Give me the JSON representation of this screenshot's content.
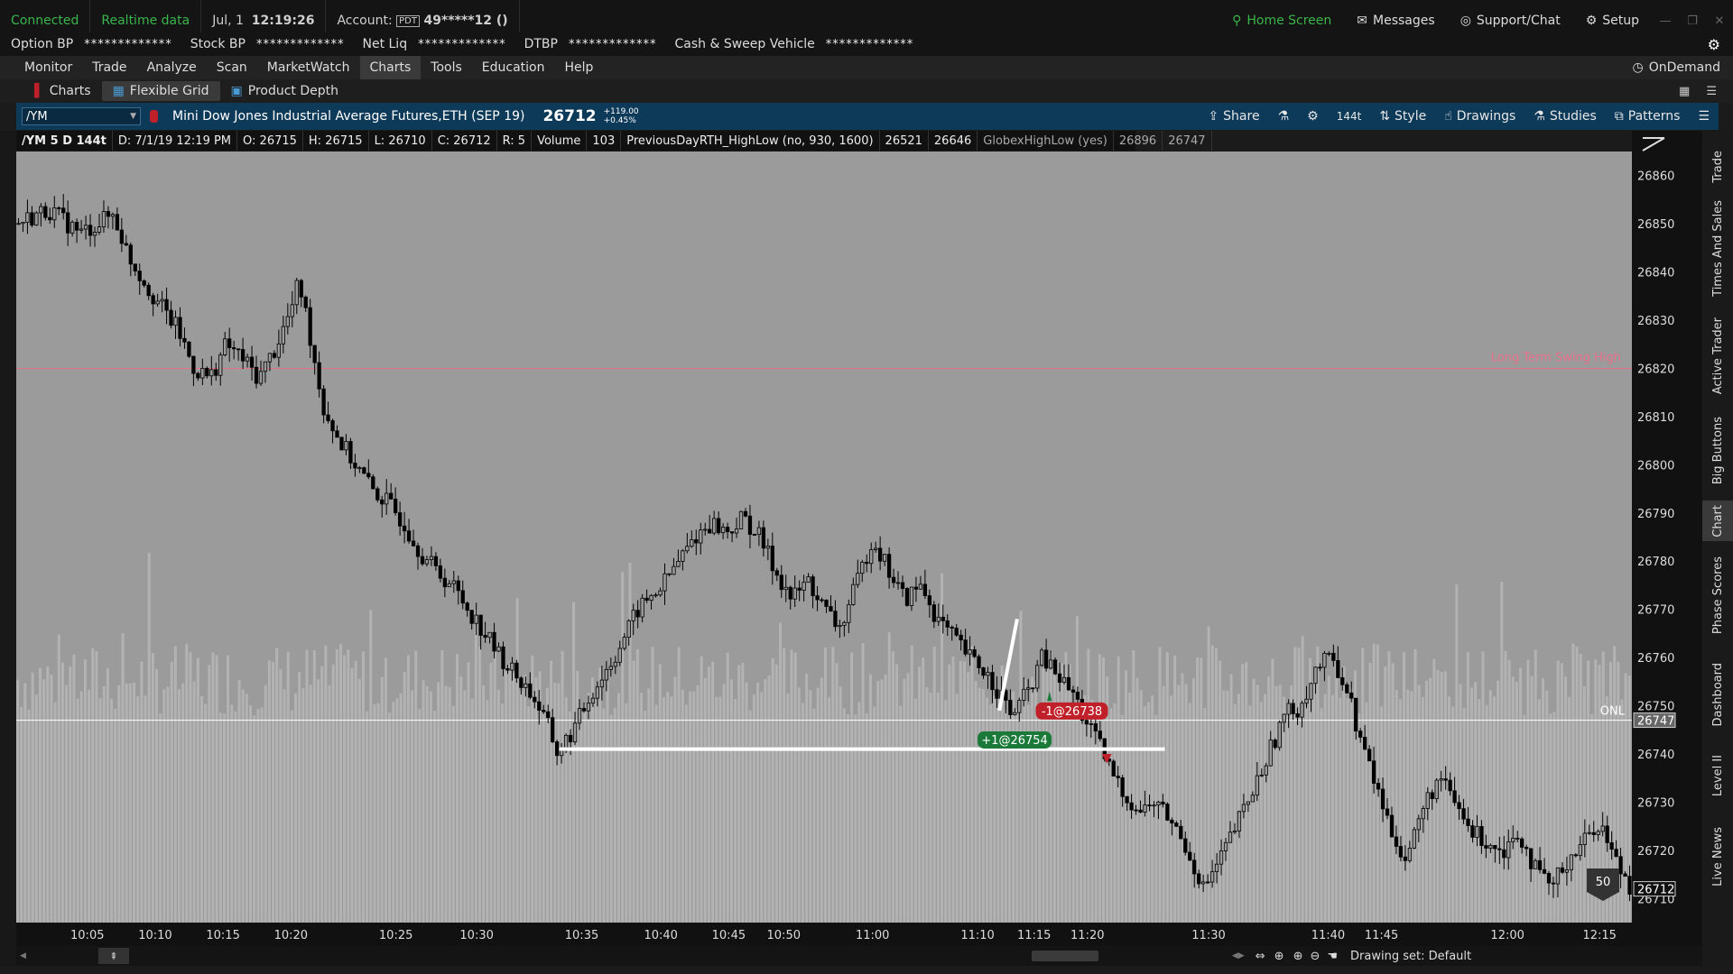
{
  "status": {
    "connected": "Connected",
    "realtime": "Realtime data",
    "date": "Jul, 1",
    "time": "12:19:26",
    "account_label": "Account:",
    "account_tag": "PDT",
    "account_value": "49*****12 ()",
    "home_screen": "Home Screen",
    "messages": "Messages",
    "support": "Support/Chat",
    "setup": "Setup"
  },
  "balances": [
    {
      "label": "Option BP",
      "value": "*************"
    },
    {
      "label": "Stock BP",
      "value": "*************"
    },
    {
      "label": "Net Liq",
      "value": "*************"
    },
    {
      "label": "DTBP",
      "value": "*************"
    },
    {
      "label": "Cash & Sweep Vehicle",
      "value": "*************"
    }
  ],
  "menu": [
    "Monitor",
    "Trade",
    "Analyze",
    "Scan",
    "MarketWatch",
    "Charts",
    "Tools",
    "Education",
    "Help"
  ],
  "menu_active": "Charts",
  "ondemand": "OnDemand",
  "subtabs": [
    "Charts",
    "Flexible Grid",
    "Product Depth"
  ],
  "header": {
    "symbol": "/YM",
    "description": "Mini Dow Jones Industrial Average Futures,ETH (SEP 19)",
    "last": "26712",
    "change": "+119.00",
    "change_pct": "+0.45%",
    "share": "Share",
    "ticks": "144t",
    "style": "Style",
    "drawings": "Drawings",
    "studies": "Studies",
    "patterns": "Patterns"
  },
  "info": {
    "symbol": "/YM 5 D 144t",
    "date": "D: 7/1/19 12:19 PM",
    "open": "O: 26715",
    "high": "H: 26715",
    "low": "L: 26710",
    "close": "C: 26712",
    "range": "R: 5",
    "volume_label": "Volume",
    "volume": "103",
    "study1": "PreviousDayRTH_HighLow (no, 930, 1600)",
    "study1_v1": "26521",
    "study1_v2": "26646",
    "study2": "GlobexHighLow (yes)",
    "study2_v1": "26896",
    "study2_v2": "26747"
  },
  "chart_data": {
    "type": "candlestick",
    "ylim": [
      26705,
      26865
    ],
    "y_ticks": [
      "26860",
      "26850",
      "26840",
      "26830",
      "26820",
      "26810",
      "26800",
      "26790",
      "26780",
      "26770",
      "26760",
      "26750",
      "26740",
      "26730",
      "26720",
      "26710"
    ],
    "x_ticks": [
      "10:05",
      "10:10",
      "10:15",
      "10:20",
      "10:25",
      "10:30",
      "10:35",
      "10:40",
      "10:45",
      "10:50",
      "11:00",
      "11:10",
      "11:15",
      "11:20",
      "11:30",
      "11:40",
      "11:45",
      "12:00",
      "12:15"
    ],
    "x_tick_pos": [
      0.044,
      0.086,
      0.128,
      0.17,
      0.235,
      0.285,
      0.35,
      0.399,
      0.441,
      0.475,
      0.53,
      0.595,
      0.63,
      0.663,
      0.738,
      0.812,
      0.845,
      0.923,
      0.98
    ],
    "price_path": [
      [
        0.0,
        26850
      ],
      [
        0.02,
        26853
      ],
      [
        0.04,
        26848
      ],
      [
        0.06,
        26852
      ],
      [
        0.07,
        26843
      ],
      [
        0.085,
        26835
      ],
      [
        0.1,
        26828
      ],
      [
        0.11,
        26820
      ],
      [
        0.12,
        26818
      ],
      [
        0.13,
        26825
      ],
      [
        0.14,
        26822
      ],
      [
        0.15,
        26818
      ],
      [
        0.16,
        26824
      ],
      [
        0.17,
        26832
      ],
      [
        0.175,
        26838
      ],
      [
        0.18,
        26830
      ],
      [
        0.19,
        26812
      ],
      [
        0.2,
        26805
      ],
      [
        0.21,
        26800
      ],
      [
        0.22,
        26795
      ],
      [
        0.23,
        26792
      ],
      [
        0.24,
        26788
      ],
      [
        0.25,
        26782
      ],
      [
        0.26,
        26778
      ],
      [
        0.27,
        26775
      ],
      [
        0.28,
        26770
      ],
      [
        0.29,
        26765
      ],
      [
        0.3,
        26760
      ],
      [
        0.31,
        26756
      ],
      [
        0.32,
        26752
      ],
      [
        0.33,
        26745
      ],
      [
        0.335,
        26740
      ],
      [
        0.345,
        26745
      ],
      [
        0.355,
        26752
      ],
      [
        0.37,
        26760
      ],
      [
        0.385,
        26770
      ],
      [
        0.4,
        26775
      ],
      [
        0.41,
        26780
      ],
      [
        0.42,
        26785
      ],
      [
        0.43,
        26788
      ],
      [
        0.44,
        26786
      ],
      [
        0.45,
        26789
      ],
      [
        0.46,
        26785
      ],
      [
        0.47,
        26778
      ],
      [
        0.48,
        26772
      ],
      [
        0.49,
        26776
      ],
      [
        0.5,
        26770
      ],
      [
        0.51,
        26766
      ],
      [
        0.52,
        26775
      ],
      [
        0.53,
        26785
      ],
      [
        0.54,
        26778
      ],
      [
        0.55,
        26772
      ],
      [
        0.56,
        26775
      ],
      [
        0.57,
        26768
      ],
      [
        0.58,
        26764
      ],
      [
        0.59,
        26760
      ],
      [
        0.6,
        26757
      ],
      [
        0.61,
        26752
      ],
      [
        0.615,
        26748
      ],
      [
        0.625,
        26752
      ],
      [
        0.635,
        26760
      ],
      [
        0.645,
        26756
      ],
      [
        0.655,
        26752
      ],
      [
        0.66,
        26748
      ],
      [
        0.665,
        26745
      ],
      [
        0.67,
        26742
      ],
      [
        0.675,
        26738
      ],
      [
        0.685,
        26732
      ],
      [
        0.695,
        26728
      ],
      [
        0.705,
        26730
      ],
      [
        0.715,
        26726
      ],
      [
        0.725,
        26720
      ],
      [
        0.735,
        26712
      ],
      [
        0.745,
        26718
      ],
      [
        0.755,
        26725
      ],
      [
        0.765,
        26732
      ],
      [
        0.775,
        26740
      ],
      [
        0.785,
        26748
      ],
      [
        0.795,
        26750
      ],
      [
        0.805,
        26758
      ],
      [
        0.815,
        26760
      ],
      [
        0.825,
        26752
      ],
      [
        0.83,
        26745
      ],
      [
        0.84,
        26735
      ],
      [
        0.85,
        26725
      ],
      [
        0.86,
        26718
      ],
      [
        0.87,
        26728
      ],
      [
        0.88,
        26735
      ],
      [
        0.89,
        26730
      ],
      [
        0.9,
        26724
      ],
      [
        0.91,
        26722
      ],
      [
        0.92,
        26720
      ],
      [
        0.93,
        26724
      ],
      [
        0.94,
        26716
      ],
      [
        0.95,
        26712
      ],
      [
        0.96,
        26718
      ],
      [
        0.97,
        26722
      ],
      [
        0.98,
        26726
      ],
      [
        0.99,
        26718
      ],
      [
        1.0,
        26712
      ]
    ],
    "hlines": [
      {
        "label": "Long Term Swing High",
        "value": 26820,
        "color": "#e8708a"
      },
      {
        "label": "ONL",
        "value": 26747,
        "color": "#ffffff"
      }
    ],
    "last_price_label": "26712",
    "onl_label": "26747",
    "buy_label": "+1@26754",
    "sell_label": "-1@26738",
    "volume_badge": "50"
  },
  "drawing_set": "Drawing set: Default",
  "side_tabs": [
    "Trade",
    "Times And Sales",
    "Active Trader",
    "Big Buttons",
    "Chart",
    "Phase Scores",
    "Dashboard",
    "Level II",
    "Live News"
  ],
  "side_active": "Chart",
  "colors": {
    "accent": "#39b54a",
    "header": "#0e3a5a",
    "buy": "#1b7a3a",
    "sell": "#c0202a"
  }
}
